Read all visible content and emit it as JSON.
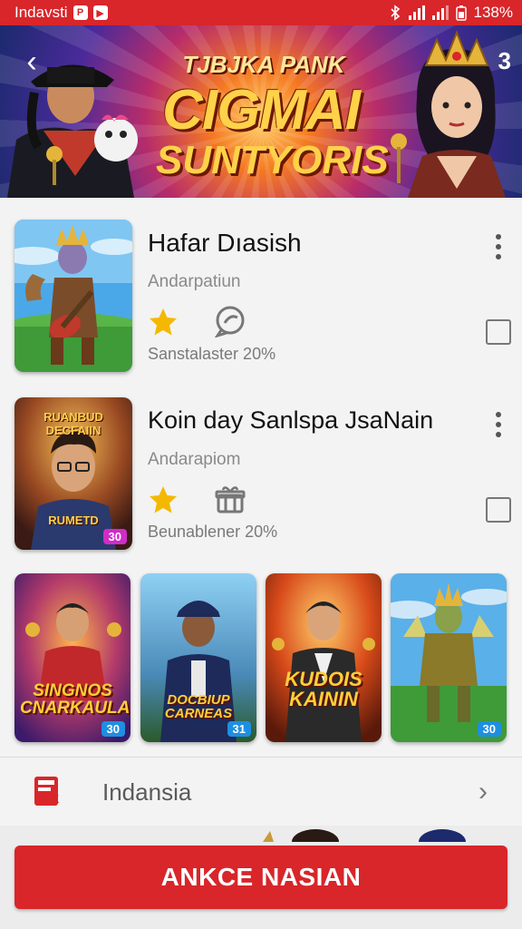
{
  "status_bar": {
    "app_name": "Indavsti",
    "app_icon_letter": "P",
    "battery": "138%"
  },
  "banner": {
    "small_title": "TJBJKA PANK",
    "big_title": "CIGMAI",
    "sub_title": "SUNTYORIS",
    "corner_number": "3"
  },
  "apps": [
    {
      "title": "Hafar Dıasish",
      "subtitle": "Andarpatiun",
      "meta": "Sanstalaster 20%",
      "icon2": "chat-bubble-icon"
    },
    {
      "title": "Koin day Sanlspa JsaNain",
      "subtitle": "Andarapiom",
      "meta": "Beunablener 20%",
      "icon2": "gift-box-icon",
      "thumb_text_top": "RUANBUD DECFAIIN",
      "thumb_text_bottom": "RUMETD",
      "badge": "30"
    }
  ],
  "grid": [
    {
      "text": "SINGNOS CNARKAULA",
      "badge": "30"
    },
    {
      "text": "DOCBIUP CARNEAS",
      "badge": "31"
    },
    {
      "text": "KUDOIS KAININ",
      "badge": ""
    },
    {
      "text": "",
      "badge": "30"
    }
  ],
  "list_row": {
    "icon_label": "APK",
    "label": "Indansia"
  },
  "cta": {
    "label": "ANKCE NASIAN"
  },
  "colors": {
    "accent": "#d8262a",
    "star": "#f5b800"
  }
}
